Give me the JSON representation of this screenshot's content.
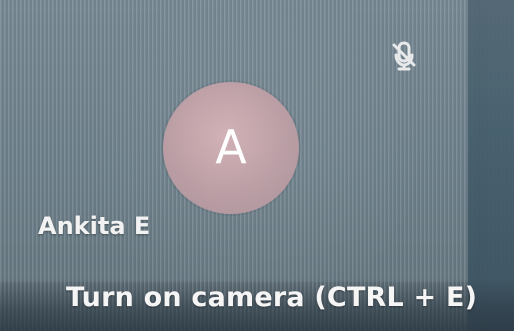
{
  "participant": {
    "avatar_initial": "A",
    "name": "Ankita E",
    "mic_icon": "microphone-muted-icon"
  },
  "hints": {
    "turn_on_camera": "Turn on camera (CTRL + E)"
  },
  "colors": {
    "background": "#73858f",
    "avatar": "#b89aa1",
    "text": "#ffffff",
    "right_edge": "#47606e"
  }
}
